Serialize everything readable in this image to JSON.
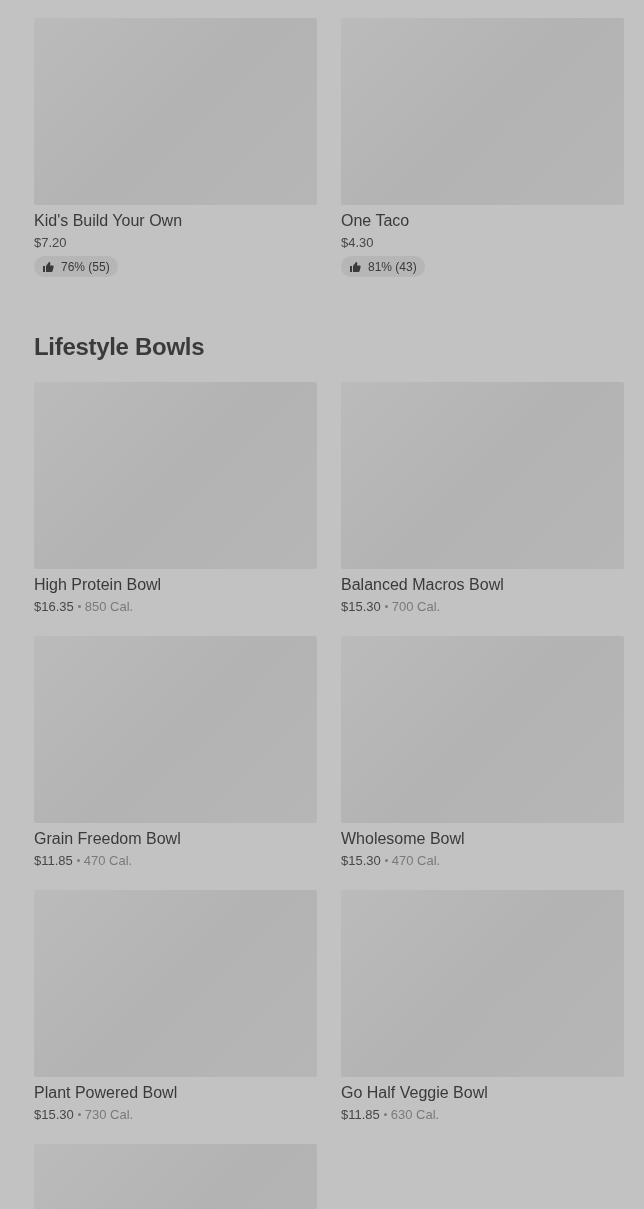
{
  "sections": [
    {
      "items": [
        {
          "kind": "dish",
          "name": "Kid's Build Your Own",
          "price": "$7.20",
          "rating": "76% (55)"
        },
        {
          "kind": "dish",
          "name": "One Taco",
          "price": "$4.30",
          "rating": "81% (43)"
        }
      ]
    },
    {
      "heading": "Lifestyle Bowls",
      "items": [
        {
          "kind": "dish",
          "name": "High Protein Bowl",
          "price": "$16.35",
          "calories": "850 Cal."
        },
        {
          "kind": "dish",
          "name": "Balanced Macros Bowl",
          "price": "$15.30",
          "calories": "700 Cal."
        },
        {
          "kind": "dish",
          "name": "Grain Freedom Bowl",
          "price": "$11.85",
          "calories": "470 Cal."
        },
        {
          "kind": "dish",
          "name": "Wholesome Bowl",
          "price": "$15.30",
          "calories": "470 Cal."
        },
        {
          "kind": "dish",
          "name": "Plant Powered Bowl",
          "price": "$15.30",
          "calories": "730 Cal."
        },
        {
          "kind": "dish",
          "name": "Go Half Veggie Bowl",
          "price": "$11.85",
          "calories": "630 Cal."
        },
        {
          "kind": "image_only"
        }
      ]
    }
  ]
}
